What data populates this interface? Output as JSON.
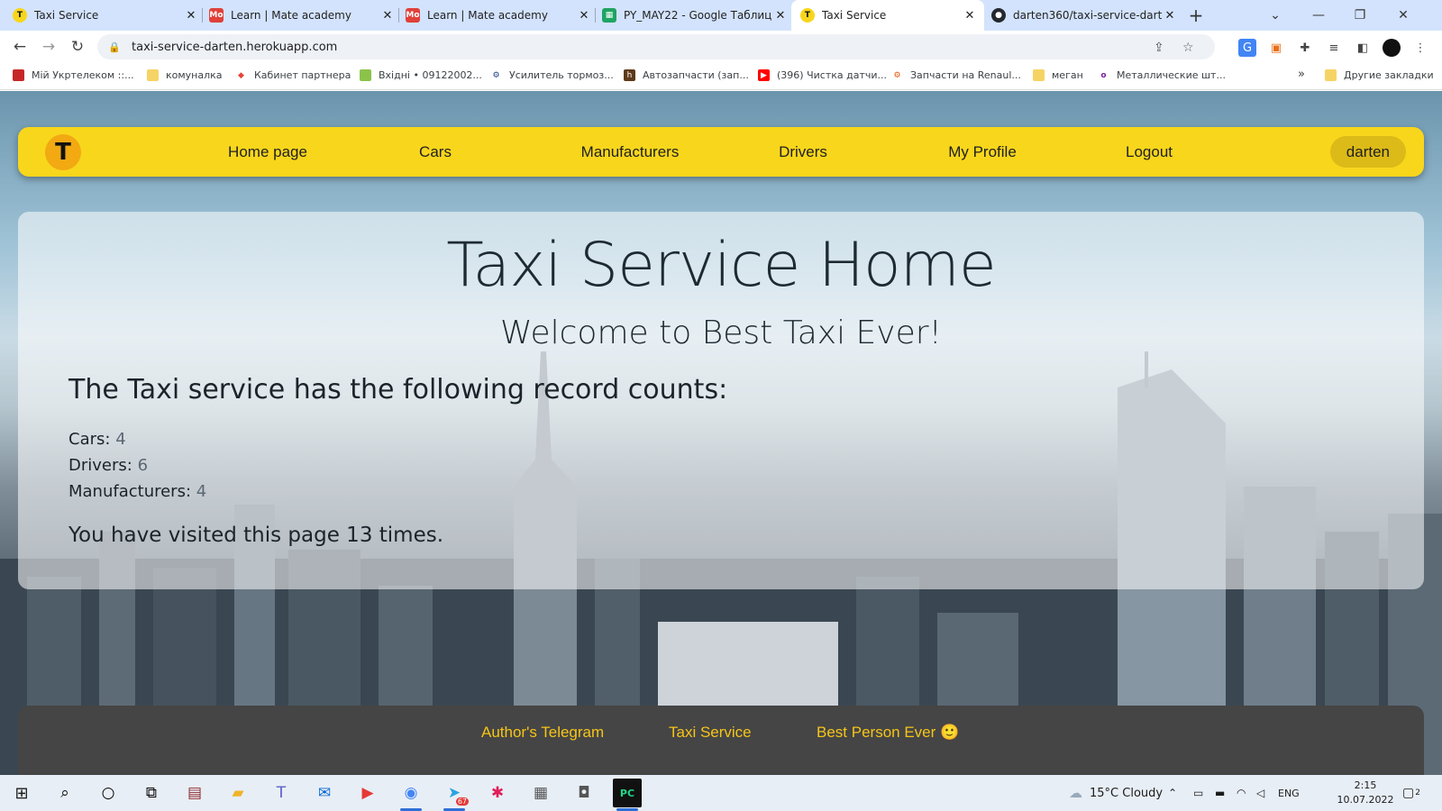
{
  "browser": {
    "tabs": [
      {
        "title": "Taxi Service",
        "favicon": "taxi-favicon",
        "active": false
      },
      {
        "title": "Learn | Mate academy",
        "favicon": "mate-favicon",
        "active": false
      },
      {
        "title": "Learn | Mate academy",
        "favicon": "mate-favicon",
        "active": false
      },
      {
        "title": "PY_MAY22 - Google Таблиц",
        "favicon": "sheets-favicon",
        "active": false
      },
      {
        "title": "Taxi Service",
        "favicon": "taxi-favicon",
        "active": true
      },
      {
        "title": "darten360/taxi-service-darten",
        "favicon": "github-favicon",
        "active": false
      }
    ],
    "address_bar": {
      "url": "taxi-service-darten.herokuapp.com"
    },
    "bookmarks": [
      {
        "label": "Мій Укртелеком ::..."
      },
      {
        "label": "комуналка"
      },
      {
        "label": "Кабинет партнера"
      },
      {
        "label": "Вхідні • 09122002..."
      },
      {
        "label": "Усилитель тормоз..."
      },
      {
        "label": "Автозапчасти (зап..."
      },
      {
        "label": "(396) Чистка датчи..."
      },
      {
        "label": "Запчасти на Renaul..."
      },
      {
        "label": "меган"
      },
      {
        "label": "Металлические шт..."
      }
    ],
    "other_bookmarks": "Другие закладки",
    "overflow": "»"
  },
  "navbar": {
    "logo_letter": "T",
    "links": [
      "Home page",
      "Cars",
      "Manufacturers",
      "Drivers",
      "My Profile",
      "Logout"
    ],
    "username": "darten"
  },
  "main": {
    "title": "Taxi Service Home",
    "subtitle": "Welcome to Best Taxi Ever!",
    "counts_heading": "The Taxi service has the following record counts:",
    "counts": [
      {
        "label": "Cars:",
        "value": "4"
      },
      {
        "label": "Drivers:",
        "value": "6"
      },
      {
        "label": "Manufacturers:",
        "value": "4"
      }
    ],
    "visits_text": "You have visited this page 13 times."
  },
  "footer": {
    "links": [
      "Author's Telegram",
      "Taxi Service",
      "Best Person Ever 🙂"
    ]
  },
  "taskbar": {
    "weather": "15°C  Cloudy",
    "language": "ENG",
    "time": "2:15",
    "date": "10.07.2022",
    "notifications": "2",
    "telegram_badge": "67"
  },
  "colors": {
    "navbar": "#f8d61c",
    "footer": "#454545",
    "footer_link": "#f5c518",
    "logo": "#f2a912"
  }
}
